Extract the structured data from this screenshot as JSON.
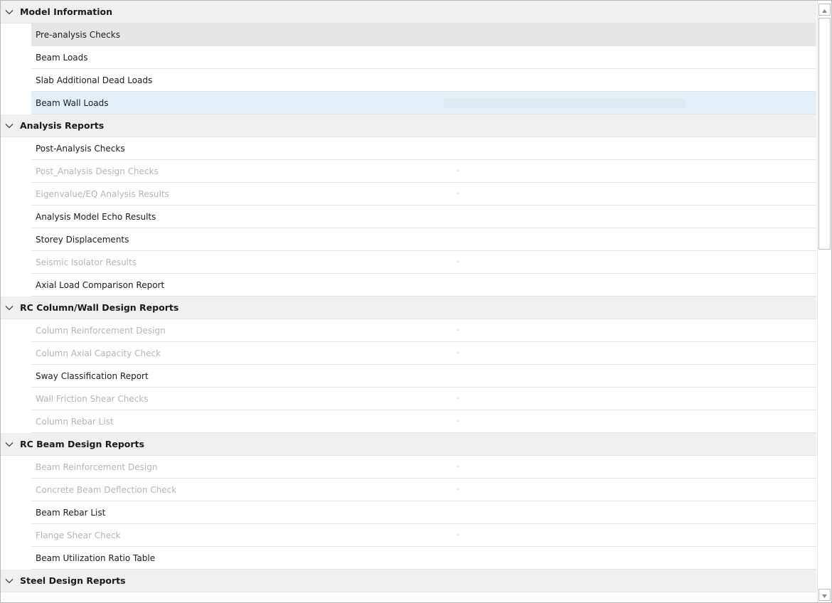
{
  "groups": [
    {
      "label": "Model Information",
      "items": [
        {
          "label": "Pre-analysis Checks",
          "state": "selected"
        },
        {
          "label": "Beam Loads",
          "state": "normal"
        },
        {
          "label": "Slab Additional Dead Loads",
          "state": "normal"
        },
        {
          "label": "Beam Wall Loads",
          "state": "hover"
        }
      ]
    },
    {
      "label": "Analysis Reports",
      "items": [
        {
          "label": "Post-Analysis Checks",
          "state": "normal"
        },
        {
          "label": "Post_Analysis Design Checks",
          "state": "disabled",
          "status": "-"
        },
        {
          "label": "Eigenvalue/EQ Analysis Results",
          "state": "disabled",
          "status": "-"
        },
        {
          "label": "Analysis Model Echo Results",
          "state": "normal"
        },
        {
          "label": "Storey Displacements",
          "state": "normal"
        },
        {
          "label": "Seismic Isolator Results",
          "state": "disabled",
          "status": "-"
        },
        {
          "label": "Axial Load Comparison Report",
          "state": "normal"
        }
      ]
    },
    {
      "label": "RC Column/Wall Design Reports",
      "items": [
        {
          "label": "Column Reinforcement Design",
          "state": "disabled",
          "status": "-"
        },
        {
          "label": "Column Axial Capacity Check",
          "state": "disabled",
          "status": "-"
        },
        {
          "label": "Sway Classification Report",
          "state": "normal"
        },
        {
          "label": "Wall Friction Shear Checks",
          "state": "disabled",
          "status": "-"
        },
        {
          "label": "Column Rebar List",
          "state": "disabled",
          "status": "-"
        }
      ]
    },
    {
      "label": "RC Beam Design Reports",
      "items": [
        {
          "label": "Beam Reinforcement Design",
          "state": "disabled",
          "status": "-"
        },
        {
          "label": "Concrete Beam Deflection Check",
          "state": "disabled",
          "status": "-"
        },
        {
          "label": "Beam Rebar List",
          "state": "normal"
        },
        {
          "label": "Flange Shear Check",
          "state": "disabled",
          "status": "-"
        },
        {
          "label": "Beam Utilization Ratio Table",
          "state": "normal"
        }
      ]
    },
    {
      "label": "Steel Design Reports",
      "items": []
    }
  ],
  "icons": {
    "expand": "chevron-down-icon",
    "scroll_up": "scroll-up-arrow-icon",
    "scroll_down": "scroll-down-arrow-icon"
  },
  "colors": {
    "group_bg": "#f0f0f0",
    "selected_bg": "#e6e6e6",
    "hover_bg": "#e4f0f9",
    "disabled_text": "#b4b4b4"
  }
}
